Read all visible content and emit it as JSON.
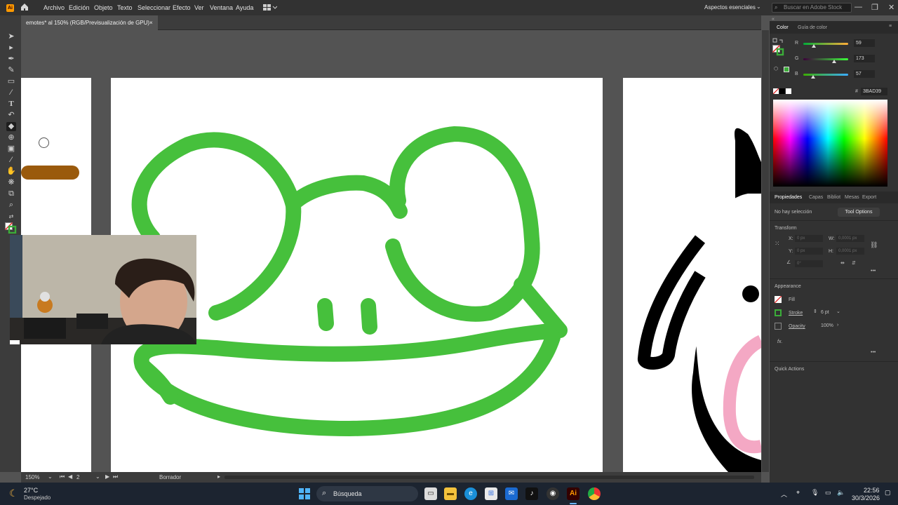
{
  "app": {
    "logo": "Ai",
    "menu": [
      "Archivo",
      "Edición",
      "Objeto",
      "Texto",
      "Seleccionar",
      "Efecto",
      "Ver",
      "Ventana",
      "Ayuda"
    ],
    "workspace": "Aspectos esenciales",
    "stock_search_placeholder": "Buscar en Adobe Stock"
  },
  "document": {
    "tab_title": "emotes* al 150% (RGB/Previsualización de GPU)",
    "tab_close": "×"
  },
  "statusbar": {
    "zoom": "150%",
    "artboard_number": "2",
    "current_tool": "Borrador"
  },
  "color_panel": {
    "tabs": [
      "Color",
      "Guía de color"
    ],
    "channels": [
      {
        "label": "R",
        "value": "59",
        "fraction": 0.23
      },
      {
        "label": "G",
        "value": "173",
        "fraction": 0.68
      },
      {
        "label": "B",
        "value": "57",
        "fraction": 0.22
      }
    ],
    "hex_label": "#",
    "hex_value": "3BAD39",
    "accent_color": "#3BAD39"
  },
  "properties_panel": {
    "tabs": [
      "Propiedades",
      "Capas",
      "Bibliot",
      "Mesas",
      "Export"
    ],
    "selection_status": "No hay selección",
    "tool_options_button": "Tool Options",
    "transform_title": "Transform",
    "x_label": "X:",
    "x_value": "0 px",
    "y_label": "Y:",
    "y_value": "0 px",
    "w_label": "W:",
    "w_value": "0,0001 px",
    "h_label": "H:",
    "h_value": "0,0001 px",
    "angle_value": "0°",
    "appearance_title": "Appearance",
    "fill_label": "Fill",
    "stroke_label": "Stroke",
    "stroke_value": "6 pt",
    "opacity_label": "Opacity",
    "opacity_value": "100%",
    "fx_label": "fx.",
    "quick_actions_title": "Quick Actions"
  },
  "taskbar": {
    "weather_temp": "27°C",
    "weather_desc": "Despejado",
    "search_label": "Búsqueda",
    "time": "22:56",
    "date": "30/3/2026"
  }
}
